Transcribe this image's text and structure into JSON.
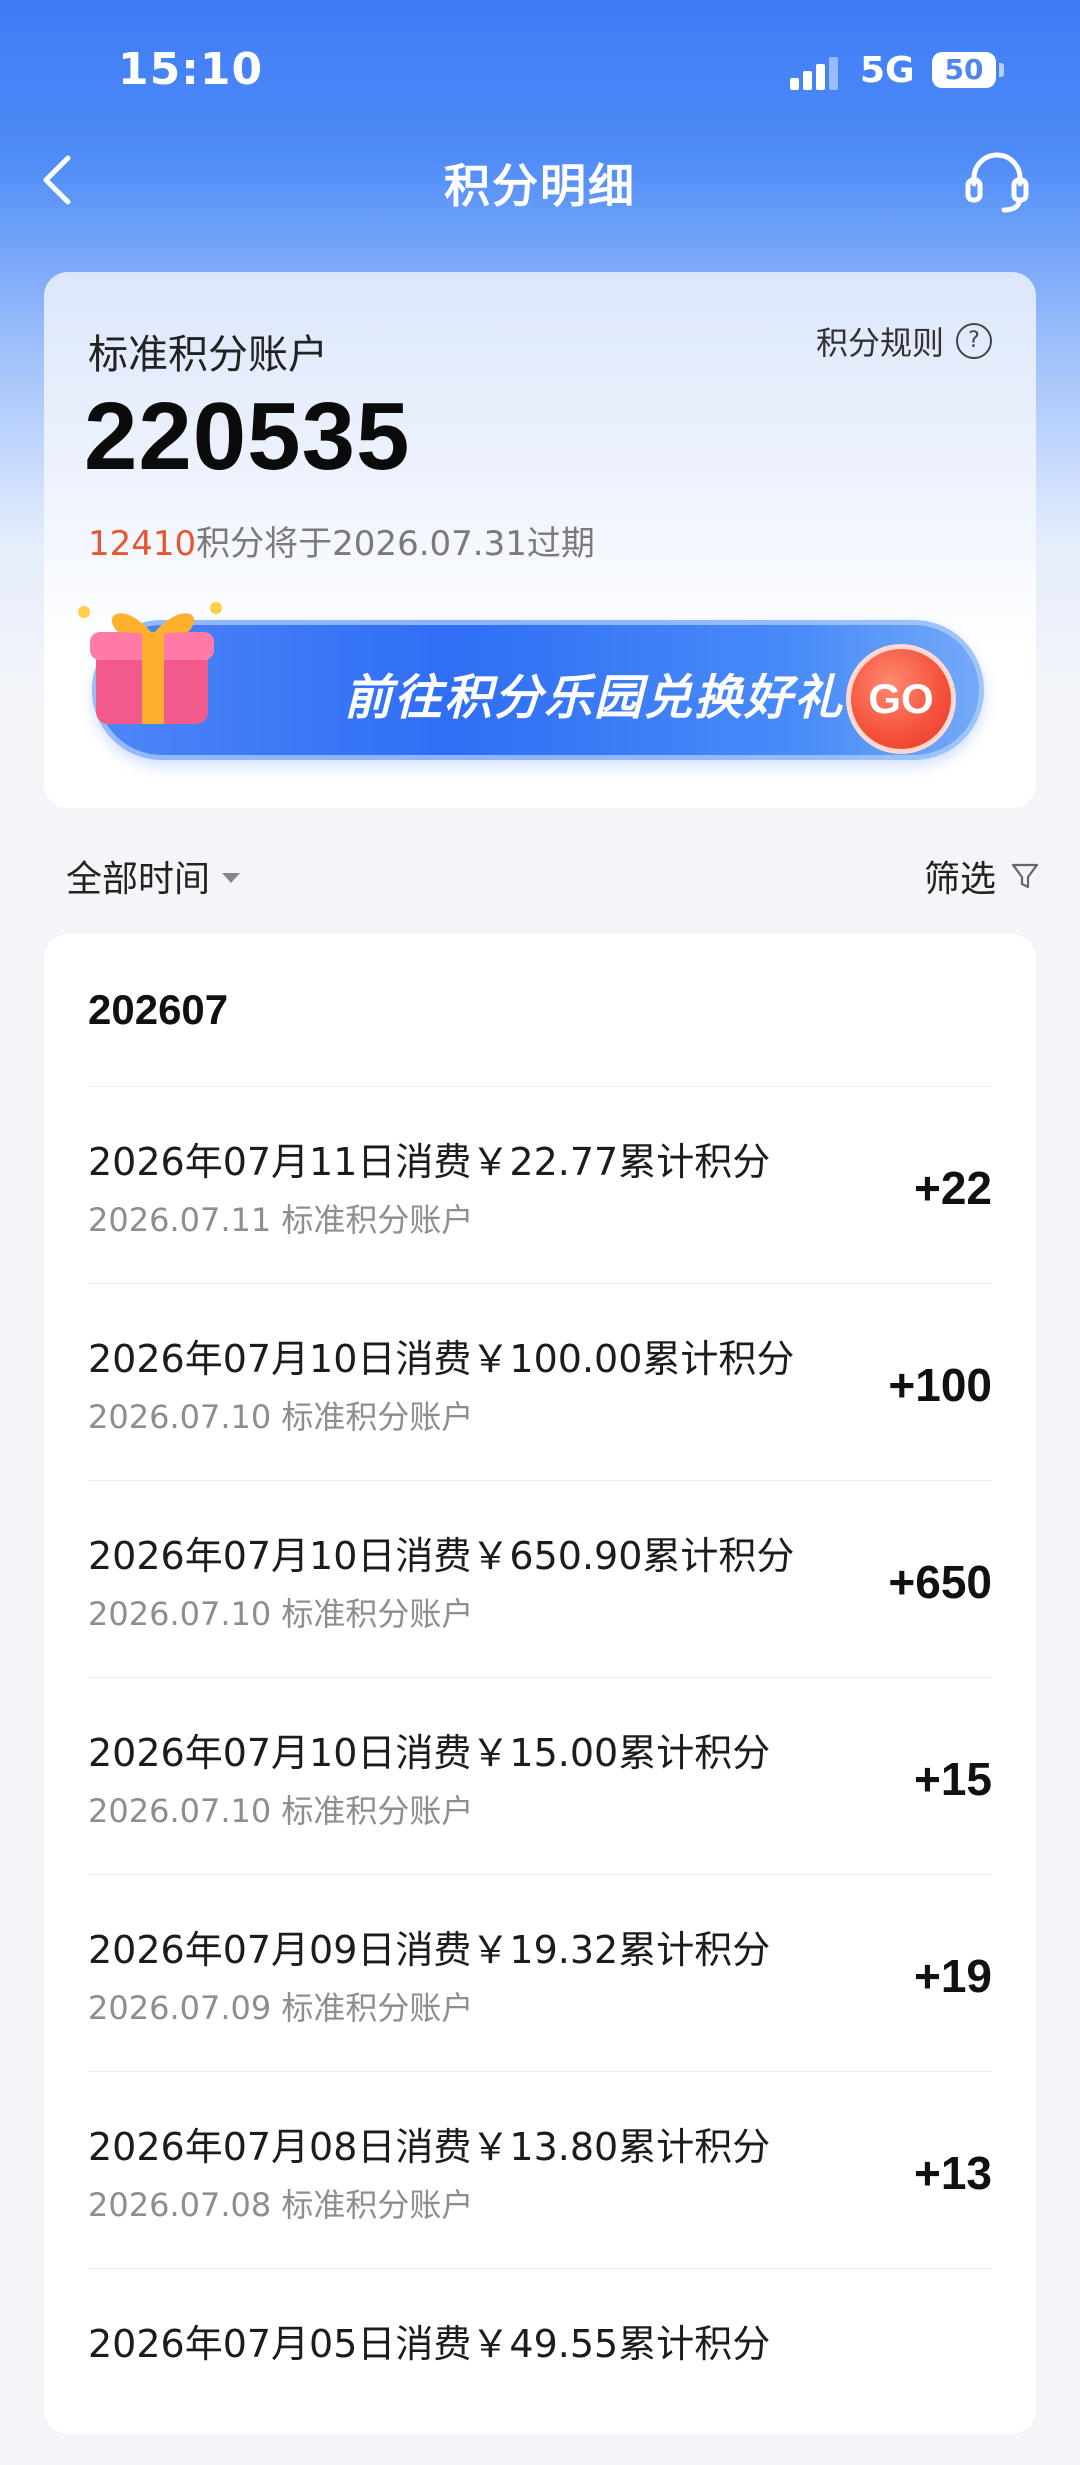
{
  "status_bar": {
    "time": "15:10",
    "network": "5G",
    "battery": "50"
  },
  "nav": {
    "title": "积分明细",
    "back_icon": "chevron-left-icon",
    "service_icon": "headset-icon"
  },
  "account": {
    "name": "标准积分账户",
    "rules_label": "积分规则",
    "balance": "220535",
    "expire_points": "12410",
    "expire_text": "积分将于2026.07.31过期",
    "promo_text": "前往积分乐园兑换好礼",
    "promo_button": "GO"
  },
  "filters": {
    "time_label": "全部时间",
    "screen_label": "筛选"
  },
  "list": {
    "month": "202607",
    "items": [
      {
        "title": "2026年07月11日消费￥22.77累计积分",
        "subtitle": "2026.07.11 标准积分账户",
        "amount": "+22"
      },
      {
        "title": "2026年07月10日消费￥100.00累计积分",
        "subtitle": "2026.07.10 标准积分账户",
        "amount": "+100"
      },
      {
        "title": "2026年07月10日消费￥650.90累计积分",
        "subtitle": "2026.07.10 标准积分账户",
        "amount": "+650"
      },
      {
        "title": "2026年07月10日消费￥15.00累计积分",
        "subtitle": "2026.07.10 标准积分账户",
        "amount": "+15"
      },
      {
        "title": "2026年07月09日消费￥19.32累计积分",
        "subtitle": "2026.07.09 标准积分账户",
        "amount": "+19"
      },
      {
        "title": "2026年07月08日消费￥13.80累计积分",
        "subtitle": "2026.07.08 标准积分账户",
        "amount": "+13"
      },
      {
        "title": "2026年07月05日消费￥49.55累计积分",
        "subtitle": "",
        "amount": ""
      }
    ]
  },
  "colors": {
    "header_blue": "#3f7cf5",
    "expire_highlight": "#e8562f",
    "go_button": "#f4503a"
  }
}
